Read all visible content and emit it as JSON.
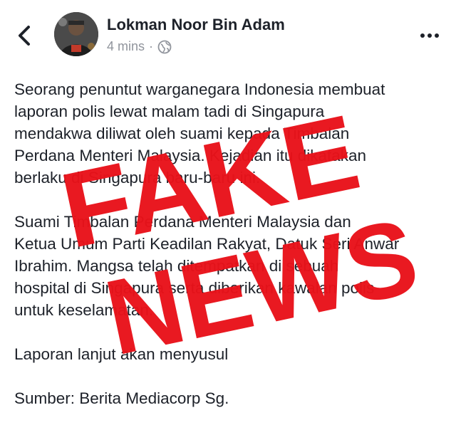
{
  "post": {
    "author_name": "Lokman Noor Bin Adam",
    "time": "4 mins",
    "separator": "·",
    "privacy_icon": "globe-icon",
    "back_icon": "chevron-left-icon",
    "more_icon": "more-options-icon",
    "paragraphs": [
      "Seorang penuntut warganegara Indonesia membuat\nlaporan polis lewat malam tadi di Singapura\nmendakwa diliwat oleh suami kepada Timbalan\nPerdana Menteri Malaysia. Kejadian itu dikatakan\nberlaku di Singapura baru-baru ini.",
      "Suami Timbalan Perdana Menteri Malaysia dan\nKetua Umum Parti Keadilan Rakyat, Datuk Seri Anwar\nIbrahim. Mangsa telah ditempatkan di sebuah\nhospital di Singapura serta diberikan kawalan polis\nuntuk keselamatan.",
      "Laporan lanjut akan menyusul",
      "Sumber: Berita Mediacorp Sg."
    ]
  },
  "stamp": {
    "line1": "FAKE",
    "line2": "NEWS",
    "color": "#e8121a"
  },
  "colors": {
    "text": "#1d2129",
    "meta": "#90949c"
  }
}
